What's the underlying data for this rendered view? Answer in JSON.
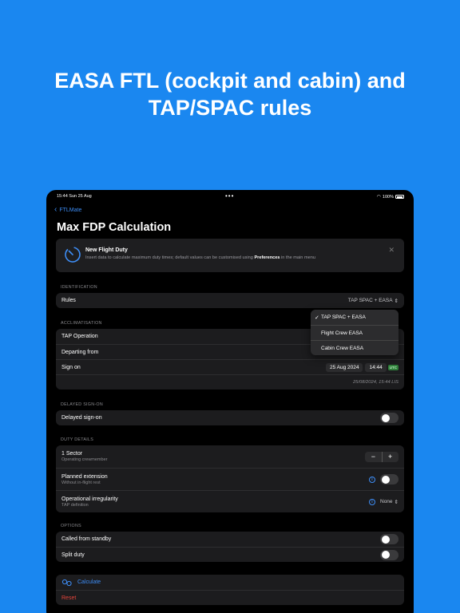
{
  "headline": {
    "line1": "EASA FTL (cockpit and cabin) and",
    "line2": "TAP/SPAC rules"
  },
  "statusbar": {
    "time": "15:44 Sun 25 Aug",
    "dots": "•••",
    "battery": "100%"
  },
  "nav": {
    "back_label": "FTLMate"
  },
  "page": {
    "title": "Max FDP Calculation"
  },
  "info_card": {
    "title": "New Flight Duty",
    "subtitle_prefix": "Insert data to calculate maximum duty times; default values can be customised using ",
    "subtitle_bold": "Preferences",
    "subtitle_suffix": " in the main menu"
  },
  "sections": {
    "identification": {
      "label": "IDENTIFICATION",
      "rules_label": "Rules",
      "rules_value": "TAP SPAC + EASA"
    },
    "acclimatisation": {
      "label": "ACCLIMATISATION",
      "tap_operation": "TAP Operation",
      "departing_from": "Departing from",
      "sign_on": "Sign on",
      "sign_on_date": "25 Aug 2024",
      "sign_on_time": "14:44",
      "utc_badge": "UTC",
      "local_time": "25/08/2024, 15:44 LIS"
    },
    "delayed": {
      "label": "DELAYED SIGN-ON",
      "delayed_sign_on": "Delayed sign-on"
    },
    "duty": {
      "label": "DUTY DETAILS",
      "sectors": "1 Sector",
      "sectors_sub": "Operating crewmember",
      "stepper_minus": "−",
      "stepper_plus": "+",
      "planned_extension": "Planned extension",
      "planned_extension_sub": "Without in-flight rest",
      "op_irregularity": "Operational irregularity",
      "op_irregularity_sub": "TAP definition",
      "op_irregularity_value": "None"
    },
    "options": {
      "label": "OPTIONS",
      "called_from_standby": "Called from standby",
      "split_duty": "Split duty"
    }
  },
  "actions": {
    "calculate": "Calculate",
    "reset": "Reset"
  },
  "dropdown": {
    "items": [
      {
        "label": "TAP SPAC + EASA",
        "checked": "✓"
      },
      {
        "label": "Flight Crew EASA",
        "checked": ""
      },
      {
        "label": "Cabin Crew EASA",
        "checked": ""
      }
    ]
  },
  "colors": {
    "background": "#1a87f0",
    "accent": "#3e8ef7",
    "destructive": "#e5453b"
  }
}
